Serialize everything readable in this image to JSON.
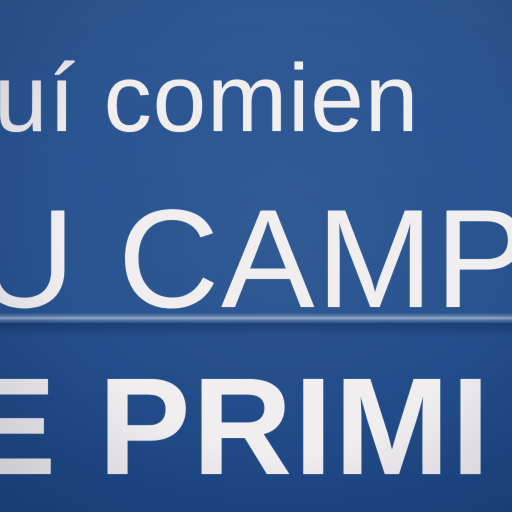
{
  "sign": {
    "line1": "uí comien",
    "line2": "U CAMP",
    "line3": "E PRIMI"
  },
  "colors": {
    "background": "#2a5592",
    "text": "#f1eef0"
  }
}
